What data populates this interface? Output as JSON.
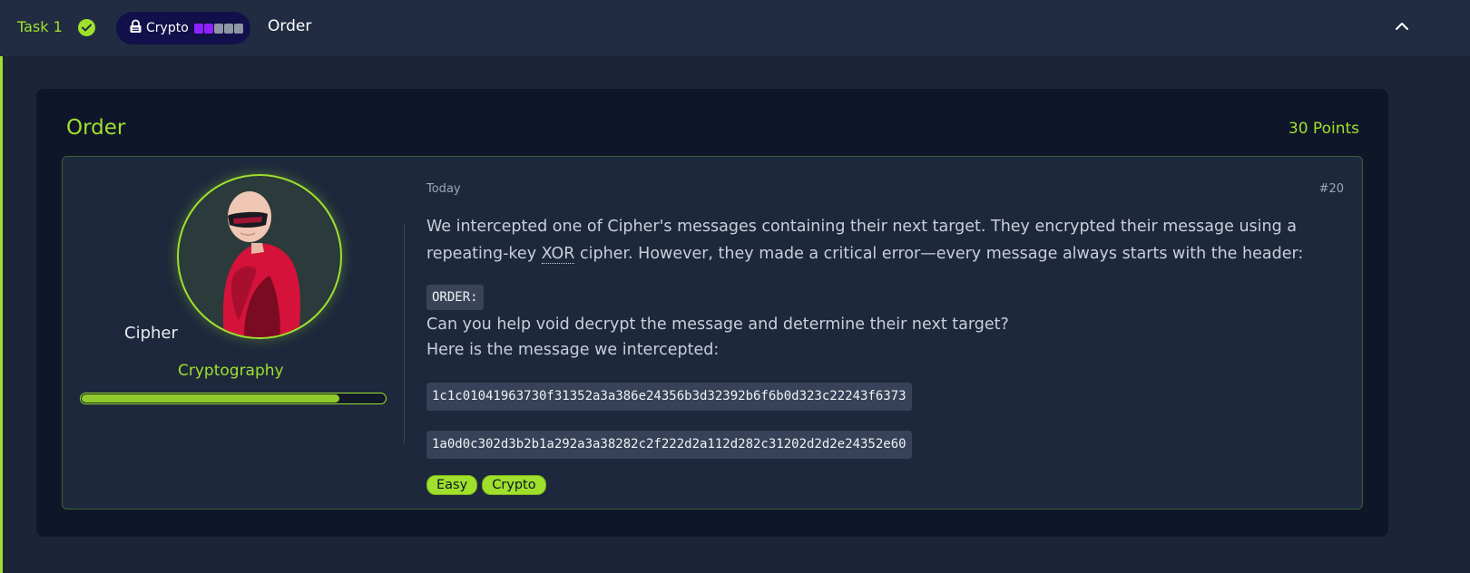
{
  "header": {
    "task_label": "Task 1",
    "category_pill": "Crypto",
    "difficulty_dots_filled": 2,
    "difficulty_dots_total": 5,
    "task_name": "Order"
  },
  "card": {
    "title": "Order",
    "points": "30 Points"
  },
  "author": {
    "name": "Cipher",
    "category": "Cryptography",
    "progress": 0.85
  },
  "message": {
    "date": "Today",
    "id": "#20",
    "intro_part1": "We intercepted one of Cipher's messages containing their next target. They encrypted their message using a repeating-key ",
    "intro_abbr": "XOR",
    "intro_part2": " cipher. However, they made a critical error—every message always starts with the header:",
    "header_code": "ORDER:",
    "question": "Can you help void decrypt the message and determine their next target?",
    "intercepted_label": "Here is the message we intercepted:",
    "hex_lines": [
      "1c1c01041963730f31352a3a386e24356b3d32392b6f6b0d323c22243f6373",
      "1a0d0c302d3b2b1a292a3a38282c2f222d2a112d282c31202d2d2e24352e60"
    ],
    "tags": [
      "Easy",
      "Crypto"
    ]
  },
  "colors": {
    "accent": "#9fe02d",
    "background": "#1c2538",
    "card": "#0f1629",
    "pill": "#12104a",
    "dot_filled": "#8e22ff"
  }
}
